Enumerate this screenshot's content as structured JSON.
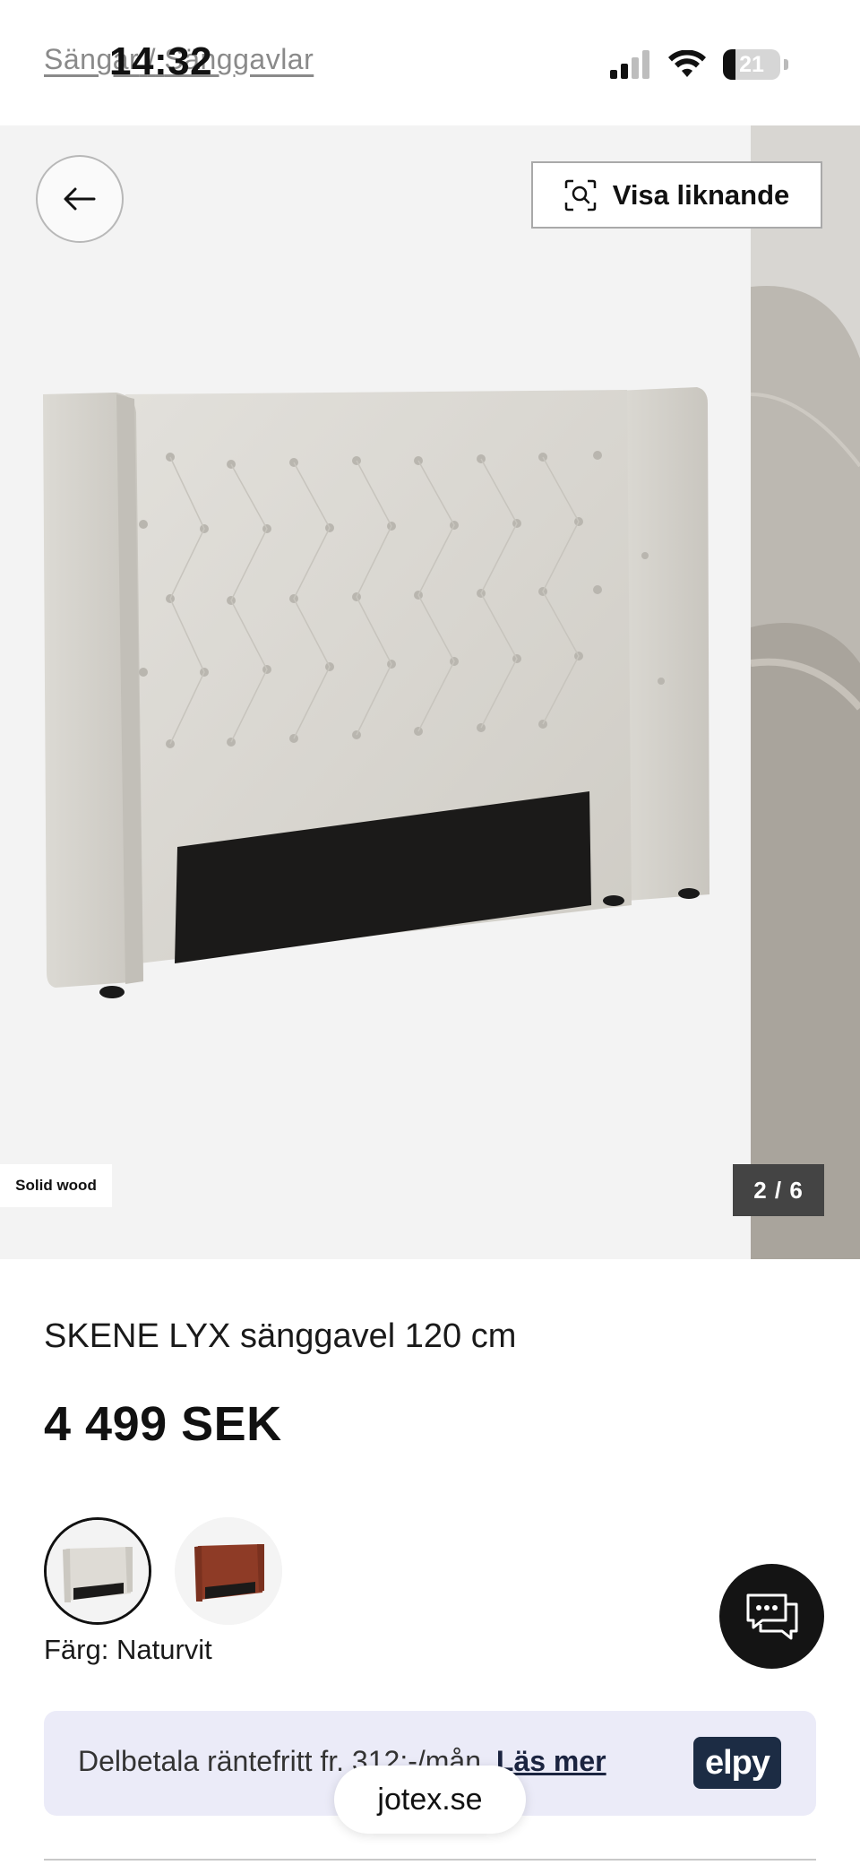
{
  "status_bar": {
    "breadcrumb_parent": "Sängar",
    "breadcrumb_separator": "/",
    "breadcrumb_current": "Sänggavlar",
    "time": "14:32",
    "battery_level": "21"
  },
  "gallery": {
    "back_icon": "arrow-left-icon",
    "similar_label": "Visa liknande",
    "similar_icon": "visual-search-icon",
    "material_tag": "Solid wood",
    "counter": "2 / 6",
    "background_color": "#f3f3f3"
  },
  "product": {
    "title": "SKENE LYX sänggavel 120 cm",
    "price": "4 499 SEK",
    "color_label": "Färg: Naturvit",
    "swatches": [
      {
        "name": "Naturvit",
        "color": "#e3e0da",
        "selected": true
      },
      {
        "name": "Rostbrun",
        "color": "#8e3b26",
        "selected": false
      }
    ]
  },
  "finance": {
    "text": "Delbetala räntefritt fr. 312:-/mån",
    "link": "Läs mer",
    "provider_logo": "elpy"
  },
  "browser": {
    "url": "jotex.se"
  },
  "colors": {
    "accent_dark": "#141414",
    "finance_bg": "#ebebf8",
    "elpy_brand": "#1c2c44"
  }
}
